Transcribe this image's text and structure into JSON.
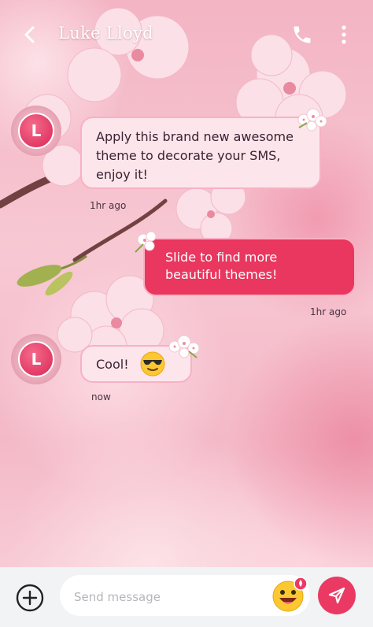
{
  "header": {
    "contact_name": "Luke Lloyd",
    "back_icon": "back-arrow-icon",
    "call_icon": "phone-icon",
    "menu_icon": "more-vertical-icon"
  },
  "messages": [
    {
      "direction": "incoming",
      "avatar_letter": "L",
      "text": "Apply this brand new awesome theme to decorate your SMS, enjoy it!",
      "time": "1hr ago"
    },
    {
      "direction": "outgoing",
      "text": "Slide to find more beautiful themes!",
      "time": "1hr ago"
    },
    {
      "direction": "incoming",
      "avatar_letter": "L",
      "text": "Cool!",
      "emoji": "sunglasses-emoji",
      "time": "now"
    }
  ],
  "composer": {
    "placeholder": "Send message",
    "add_icon": "plus-circle-icon",
    "emoji_icon": "emoji-icon",
    "send_icon": "send-icon"
  },
  "colors": {
    "accent": "#ea3a63",
    "incoming_bubble": "#fde5ec",
    "incoming_border": "#f6b2c4",
    "outgoing_bubble": "#e9375f"
  }
}
